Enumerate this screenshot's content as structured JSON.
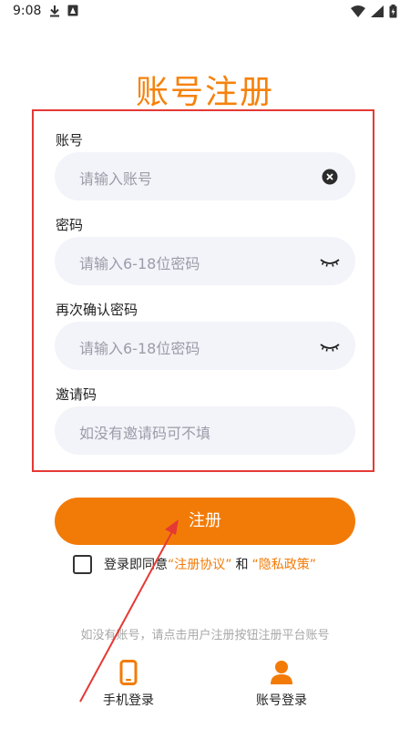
{
  "status_bar": {
    "time": "9:08"
  },
  "page": {
    "title": "账号注册"
  },
  "form": {
    "account": {
      "label": "账号",
      "placeholder": "请输入账号"
    },
    "password": {
      "label": "密码",
      "placeholder": "请输入6-18位密码"
    },
    "confirm_password": {
      "label": "再次确认密码",
      "placeholder": "请输入6-18位密码"
    },
    "invite_code": {
      "label": "邀请码",
      "placeholder": "如没有邀请码可不填"
    }
  },
  "register_button": {
    "label": "注册"
  },
  "agreement": {
    "prefix": "登录即同意",
    "terms_link": "“注册协议”",
    "and": "和",
    "privacy_link": "“隐私政策”"
  },
  "hint": "如没有账号，请点击用户注册按钮注册平台账号",
  "bottom_tabs": [
    {
      "label": "手机登录",
      "icon": "phone-icon"
    },
    {
      "label": "账号登录",
      "icon": "user-icon"
    }
  ],
  "colors": {
    "accent": "#F27B07",
    "annotation_red": "#E53935",
    "input_bg": "#F3F4F9"
  }
}
